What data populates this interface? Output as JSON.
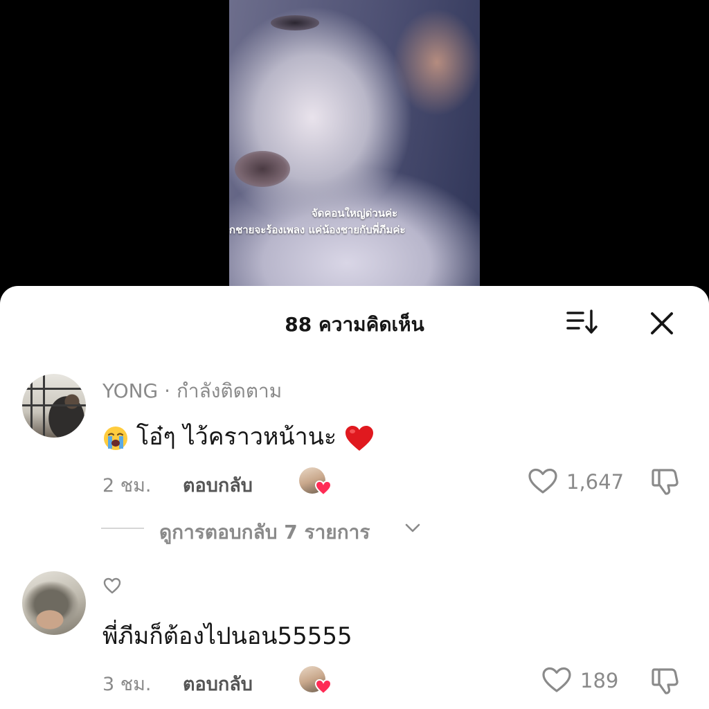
{
  "video": {
    "caption_line1": "จัดคอนใหญ่ด่วนค่ะ",
    "caption_line2": "กชายจะร้องเพลง แค่น้องชายกับพี่ภีมค่ะ"
  },
  "sheet": {
    "title": "88 ความคิดเห็น",
    "sort_icon": "sort-icon",
    "close_icon": "close-icon"
  },
  "comments": [
    {
      "username": "YONG",
      "separator": " · ",
      "follow_status": "กำลังติดตาม",
      "text": "โอ๋ๆ ไว้คราวหน้านะ",
      "leading_emoji": "loudly-crying-face",
      "trailing_emoji": "red-heart",
      "time": "2 ชม.",
      "reply_label": "ตอบกลับ",
      "likes": "1,647",
      "replies_label": "ดูการตอบกลับ 7 รายการ"
    },
    {
      "username": "",
      "text": "พี่ภีมก็ต้องไปนอน55555",
      "time": "3 ชม.",
      "reply_label": "ตอบกลับ",
      "likes": "189"
    }
  ],
  "colors": {
    "accent_heart": "#fe2c55",
    "muted_text": "#8a8a8a",
    "primary_text": "#161616",
    "sheet_bg": "#ffffff"
  }
}
